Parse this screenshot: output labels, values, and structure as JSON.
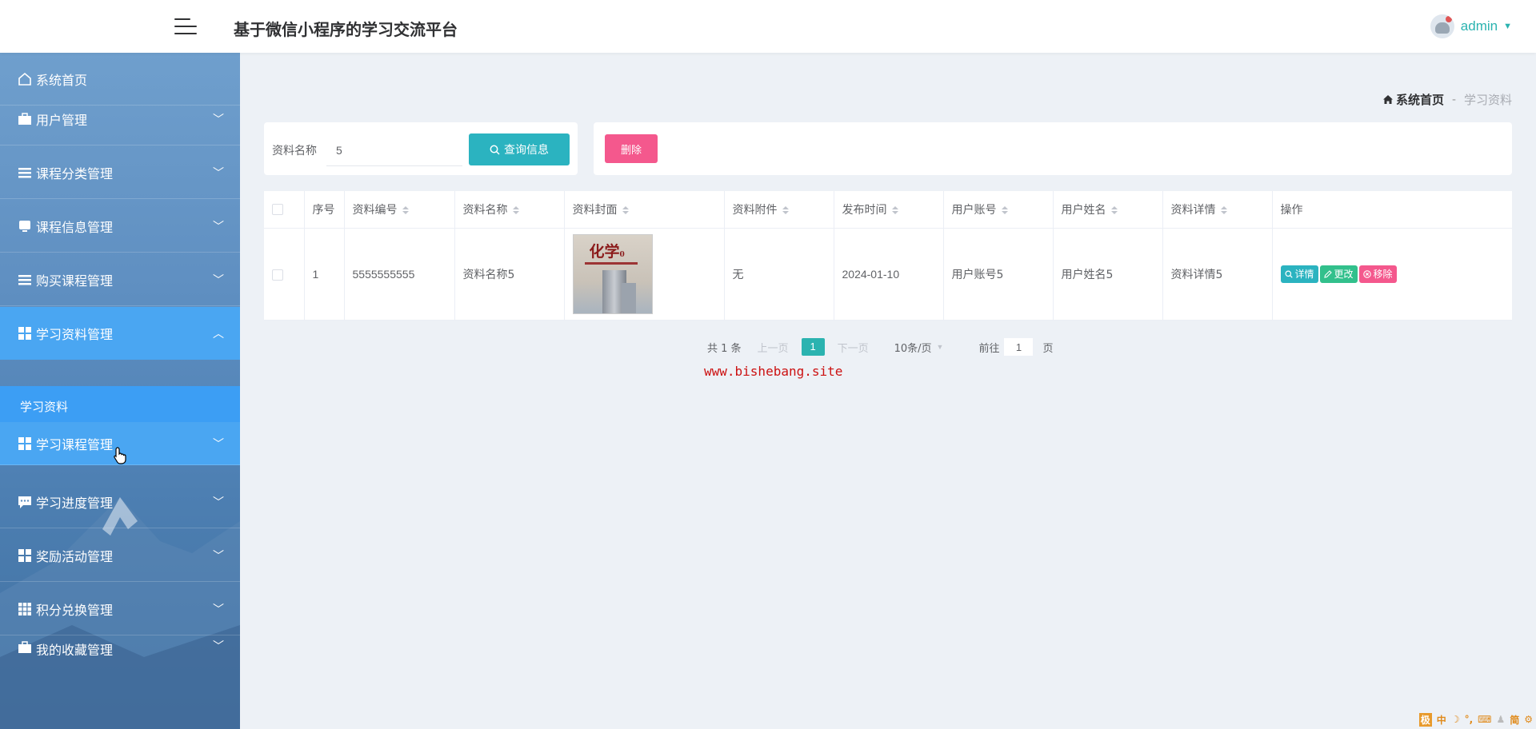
{
  "header": {
    "title": "基于微信小程序的学习交流平台",
    "user": "admin"
  },
  "sidebar": {
    "items": [
      {
        "label": "系统首页",
        "icon": "home-icon"
      },
      {
        "label": "用户管理",
        "icon": "briefcase-icon"
      },
      {
        "label": "课程分类管理",
        "icon": "list-icon"
      },
      {
        "label": "课程信息管理",
        "icon": "monitor-icon"
      },
      {
        "label": "购买课程管理",
        "icon": "list-icon"
      },
      {
        "label": "学习资料管理",
        "icon": "grid-icon"
      },
      {
        "label": "学习课程管理",
        "icon": "grid-icon"
      },
      {
        "label": "学习进度管理",
        "icon": "chat-icon"
      },
      {
        "label": "奖励活动管理",
        "icon": "grid-icon"
      },
      {
        "label": "积分兑换管理",
        "icon": "grid9-icon"
      },
      {
        "label": "我的收藏管理",
        "icon": "briefcase-icon"
      }
    ],
    "submenu": {
      "label": "学习资料"
    }
  },
  "breadcrumb": {
    "home": "系统首页",
    "separator": "-",
    "current": "学习资料"
  },
  "search": {
    "label": "资料名称",
    "value": "5",
    "button": "查询信息"
  },
  "actions": {
    "delete": "删除"
  },
  "table": {
    "columns": [
      "序号",
      "资料编号",
      "资料名称",
      "资料封面",
      "资料附件",
      "发布时间",
      "用户账号",
      "用户姓名",
      "资料详情",
      "操作"
    ],
    "rows": [
      {
        "index": "1",
        "code": "5555555555",
        "name": "资料名称5",
        "cover_title": "化学",
        "cover_sub": "0",
        "attachment": "无",
        "published": "2024-01-10",
        "account": "用户账号5",
        "user_name": "用户姓名5",
        "detail": "资料详情5"
      }
    ],
    "ops": {
      "detail": "详情",
      "edit": "更改",
      "remove": "移除"
    }
  },
  "pagination": {
    "total": "共 1 条",
    "prev": "上一页",
    "current": "1",
    "next": "下一页",
    "page_size": "10条/页",
    "goto": "前往",
    "goto_value": "1",
    "page_unit": "页"
  },
  "watermark": "www.bishebang.site",
  "ime": {
    "logo": "极",
    "mode": "中",
    "simp": "简"
  },
  "colors": {
    "accent": "#2bb3c0",
    "danger": "#f4588d",
    "success": "#32c08c",
    "sidebar_active": "#4aa6f2"
  }
}
